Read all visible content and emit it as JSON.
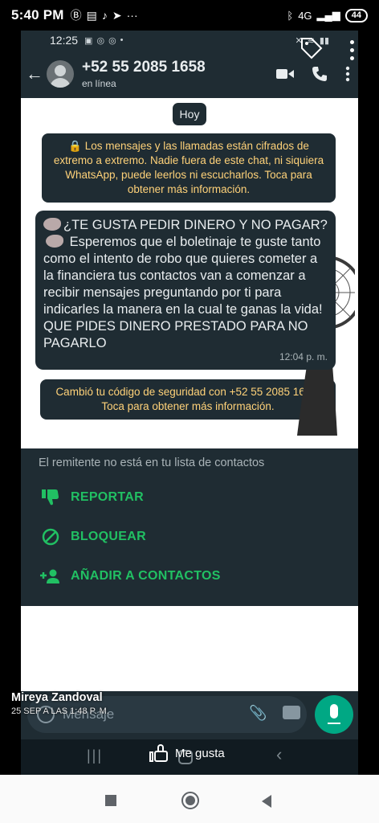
{
  "device_status": {
    "time": "5:40 PM",
    "network": "4G",
    "battery": "44"
  },
  "inner_status": {
    "time": "12:25"
  },
  "header": {
    "contact_name": "+52 55 2085 1658",
    "contact_status": "en línea"
  },
  "chat": {
    "date_chip": "Hoy",
    "encryption_notice": "Los mensajes y las llamadas están cifrados de extremo a extremo. Nadie fuera de este chat, ni siquiera WhatsApp, puede leerlos ni escucharlos. Toca para obtener más información.",
    "message_line1": "¿TE GUSTA PEDIR DINERO Y NO PAGAR?",
    "message_body": "Esperemos que el boletinaje te guste tanto como el intento de robo que quieres cometer a la financiera tus contactos van a comenzar a recibir mensajes preguntando por ti para indicarles la manera en la cual te ganas la vida!  QUE PIDES DINERO PRESTADO PARA NO PAGARLO",
    "message_time": "12:04 p. m.",
    "security_notice": "Cambió tu código de seguridad con +52 55 2085 1658. Toca para obtener más información."
  },
  "unknown_sender": {
    "note": "El remitente no está en tu lista de contactos",
    "actions": [
      {
        "label": "REPORTAR",
        "icon": "thumb-down-icon"
      },
      {
        "label": "BLOQUEAR",
        "icon": "block-icon"
      },
      {
        "label": "AÑADIR A CONTACTOS",
        "icon": "add-contact-icon"
      }
    ]
  },
  "compose": {
    "placeholder": "Mensaje"
  },
  "post_overlay": {
    "author": "Mireya Zandoval",
    "date": "25 SEP A LAS 1:48 P. M.",
    "like_label": "Me gusta"
  },
  "colors": {
    "panel": "#1f2c33",
    "accent_green": "#21c063",
    "notice_yellow": "#ffd279",
    "mic_button": "#00a884"
  }
}
